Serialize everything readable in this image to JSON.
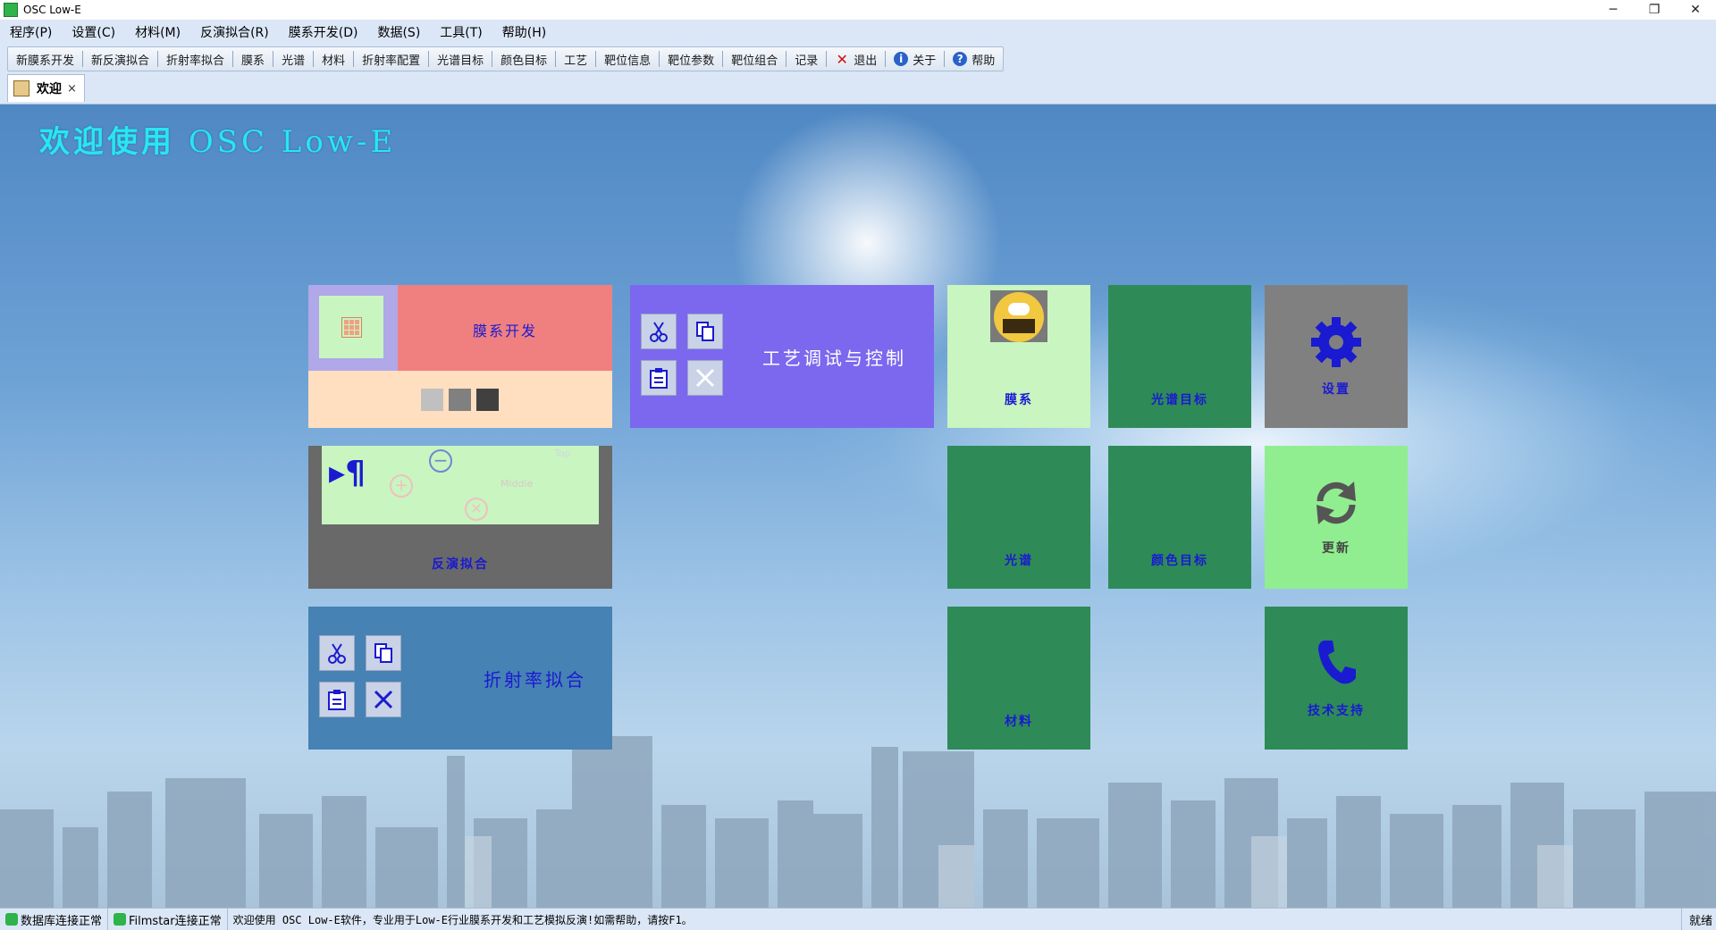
{
  "window": {
    "title": "OSC Low-E",
    "minimize": "─",
    "restore": "❐",
    "close": "✕"
  },
  "menu": [
    "程序(P)",
    "设置(C)",
    "材料(M)",
    "反演拟合(R)",
    "膜系开发(D)",
    "数据(S)",
    "工具(T)",
    "帮助(H)"
  ],
  "toolbar": {
    "group1": [
      "新膜系开发",
      "新反演拟合",
      "折射率拟合"
    ],
    "group2": [
      "膜系",
      "光谱",
      "材料",
      "折射率配置",
      "光谱目标",
      "颜色目标",
      "工艺",
      "靶位信息",
      "靶位参数",
      "靶位组合",
      "记录"
    ],
    "exit": "退出",
    "about": "关于",
    "help": "帮助"
  },
  "tab": {
    "label": "欢迎",
    "close": "×"
  },
  "welcome": {
    "part1": "欢迎使用",
    "part2": "OSC Low-E"
  },
  "tiles": {
    "film_dev": "膜系开发",
    "process": "工艺调试与控制",
    "film_system": "膜系",
    "spectrum_target": "光谱目标",
    "settings": "设置",
    "inverse_fit": "反演拟合",
    "inverse_fit_texts": [
      "Top",
      "Middle"
    ],
    "spectrum": "光谱",
    "color_target": "颜色目标",
    "update": "更新",
    "refractive_fit": "折射率拟合",
    "material": "材料",
    "support": "技术支持"
  },
  "colors": {
    "salmon": "#f08080",
    "purple": "#7b68ee",
    "lightgreen": "#c8f5c0",
    "darkgreen": "#2e8b57",
    "gray": "#808080",
    "steel": "#4682b4",
    "peach": "#ffdfc0",
    "midgray": "#696969",
    "update_green": "#90ee90"
  },
  "status": {
    "db": "数据库连接正常",
    "filmstar": "Filmstar连接正常",
    "message": "欢迎使用 OSC Low-E软件，专业用于Low-E行业膜系开发和工艺模拟反演!如需帮助，请按F1。",
    "ready": "就绪"
  }
}
